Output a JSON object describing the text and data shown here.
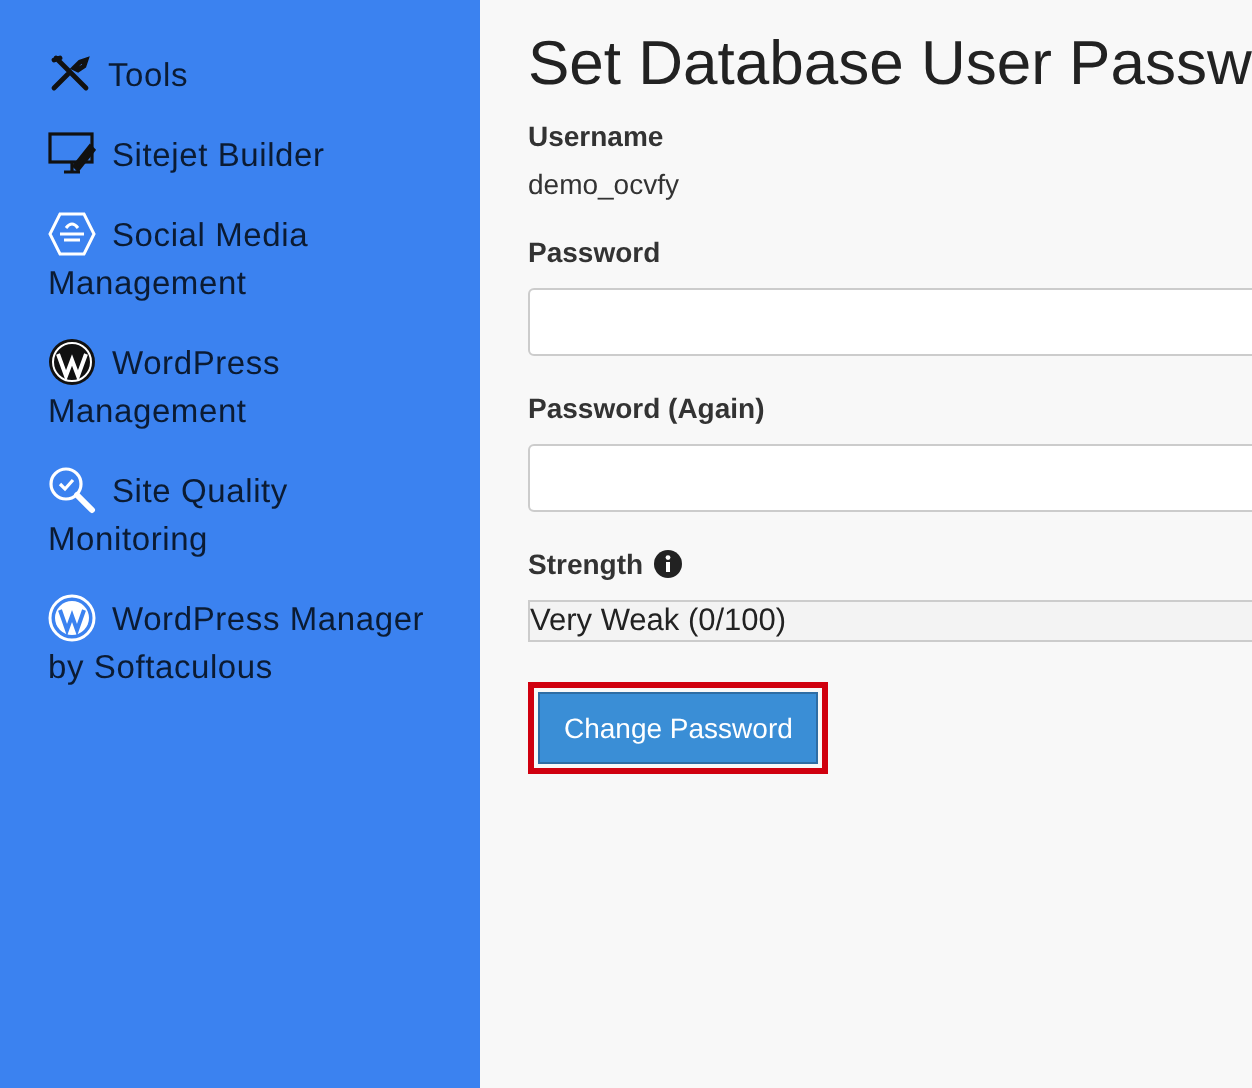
{
  "sidebar": {
    "items": [
      {
        "label": "Tools",
        "kind": "tools"
      },
      {
        "label": "Sitejet Builder",
        "kind": "monitor"
      },
      {
        "label": "Social Media Management",
        "kind": "hexagon"
      },
      {
        "label": "WordPress Management",
        "kind": "wordpress"
      },
      {
        "label": "Site Quality Monitoring",
        "kind": "magnifier"
      },
      {
        "label": "WordPress Manager by Softaculous",
        "kind": "wordpress-outline"
      }
    ]
  },
  "form": {
    "title": "Set Database User Passw",
    "username_label": "Username",
    "username": "demo_ocvfy",
    "fields": [
      {
        "label": "Password"
      },
      {
        "label": "Password (Again)"
      }
    ],
    "strength": {
      "label": "Strength",
      "level": 0,
      "reading": "Very Weak (0/100)"
    },
    "button": {
      "label": "Change Password",
      "highlighted": true
    }
  }
}
